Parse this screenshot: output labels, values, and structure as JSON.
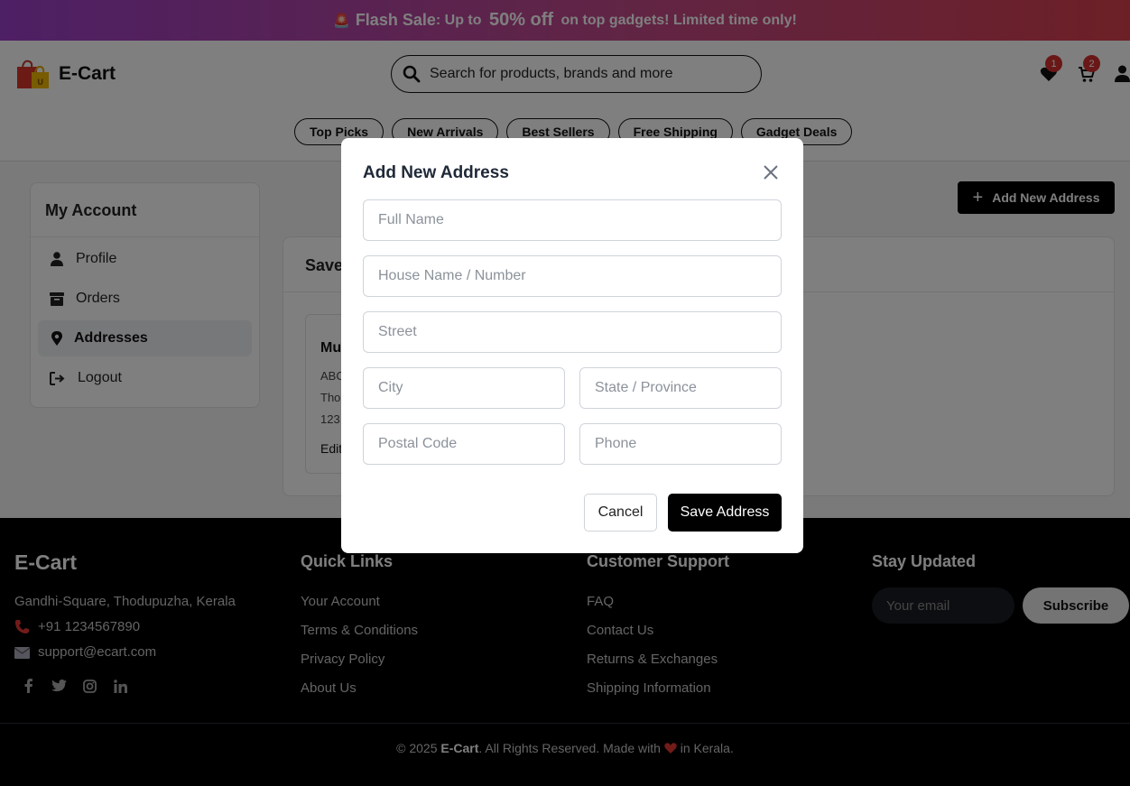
{
  "flash_bar": {
    "icon": "siren-icon",
    "strong": "Flash Sale",
    "text1": ": Up to ",
    "big": "50% off",
    "text2": " on top gadgets! Limited time only!"
  },
  "header": {
    "logo_text": "E-Cart",
    "search_placeholder": "Search for products, brands and more",
    "wishlist_count": "1",
    "cart_count": "2",
    "pills": [
      "Top Picks",
      "New Arrivals",
      "Best Sellers",
      "Free Shipping",
      "Gadget Deals"
    ]
  },
  "sidebar": {
    "title": "My Account",
    "items": [
      {
        "label": "Profile",
        "icon": "user-icon"
      },
      {
        "label": "Orders",
        "icon": "box-icon"
      },
      {
        "label": "Addresses",
        "icon": "map-pin-icon",
        "active": true
      },
      {
        "label": "Logout",
        "icon": "logout-icon"
      }
    ]
  },
  "main": {
    "add_button": "Add New Address",
    "saved_title": "Saved",
    "card": {
      "name": "Mu",
      "line1": "ABC",
      "line2": "Tho",
      "line3": "123",
      "edit": "Edit"
    }
  },
  "footer": {
    "brand": "E-Cart",
    "address": "Gandhi-Square, Thodupuzha, Kerala",
    "phone": "+91 1234567890",
    "email": "support@ecart.com",
    "quick_links_title": "Quick Links",
    "quick_links": [
      "Your Account",
      "Terms & Conditions",
      "Privacy Policy",
      "About Us"
    ],
    "support_title": "Customer Support",
    "support_links": [
      "FAQ",
      "Contact Us",
      "Returns & Exchanges",
      "Shipping Information"
    ],
    "newsletter_title": "Stay Updated",
    "newsletter_placeholder": "Your email",
    "subscribe": "Subscribe",
    "copy_pre": "© 2025 ",
    "copy_brand": "E-Cart",
    "copy_mid": ". All Rights Reserved. Made with ",
    "copy_post": " in Kerala."
  },
  "modal": {
    "title": "Add New Address",
    "full_name_placeholder": "Full Name",
    "house_placeholder": "House Name / Number",
    "street_placeholder": "Street",
    "city_placeholder": "City",
    "state_placeholder": "State / Province",
    "postal_placeholder": "Postal Code",
    "phone_placeholder": "Phone",
    "cancel": "Cancel",
    "save": "Save Address"
  }
}
